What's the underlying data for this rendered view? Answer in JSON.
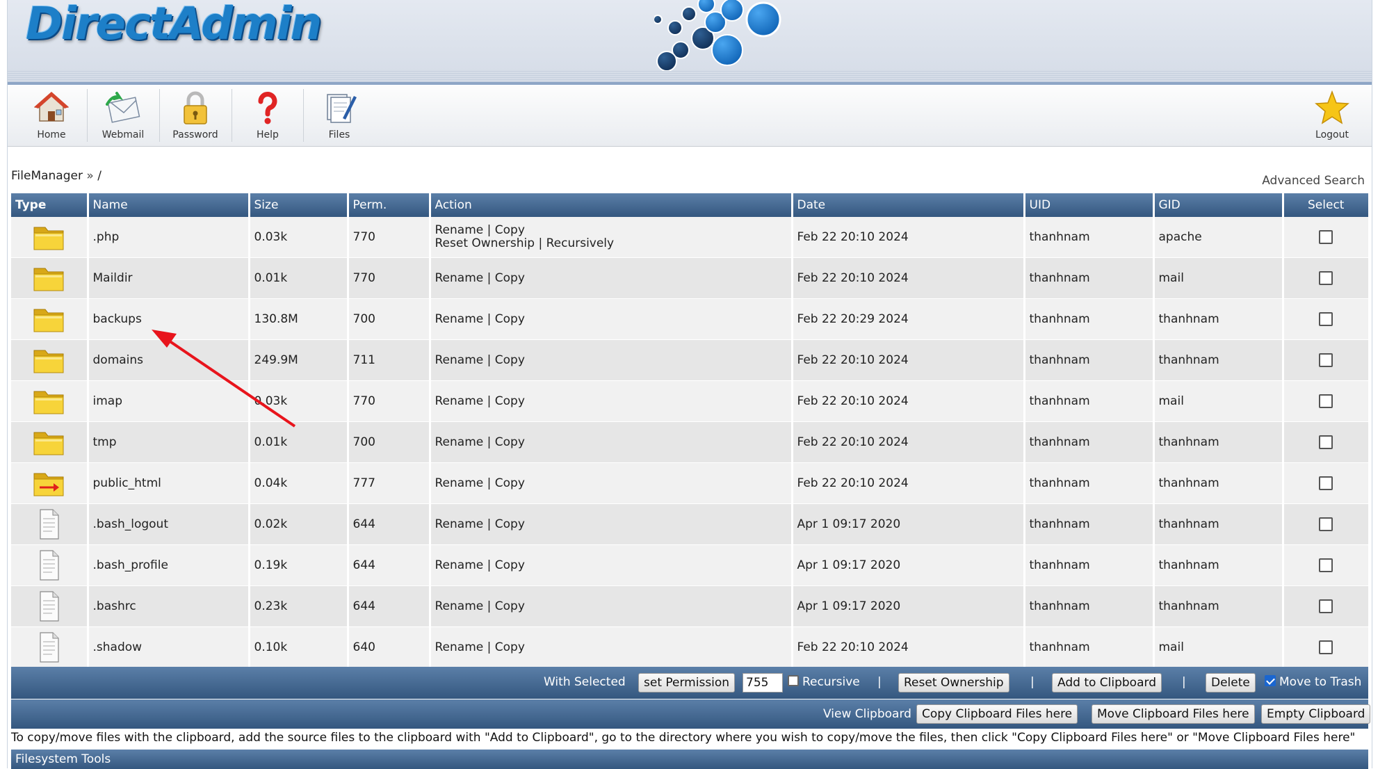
{
  "header": {
    "logo_text": "DirectAdmin"
  },
  "toolbar": {
    "items": [
      {
        "label": "Home",
        "icon": "home-icon"
      },
      {
        "label": "Webmail",
        "icon": "webmail-icon"
      },
      {
        "label": "Password",
        "icon": "password-lock-icon"
      },
      {
        "label": "Help",
        "icon": "help-question-icon"
      },
      {
        "label": "Files",
        "icon": "files-icon"
      }
    ],
    "logout": {
      "label": "Logout",
      "icon": "logout-star-icon"
    }
  },
  "breadcrumb": {
    "root": "FileManager",
    "separator": "»",
    "path": "/"
  },
  "advanced_search": "Advanced Search",
  "table": {
    "headers": {
      "type": "Type",
      "name": "Name",
      "size": "Size",
      "perm": "Perm.",
      "action": "Action",
      "date": "Date",
      "uid": "UID",
      "gid": "GID",
      "select": "Select"
    },
    "actions": {
      "rename": "Rename",
      "copy": "Copy",
      "pipe": "|",
      "reset_ownership": "Reset Ownership",
      "recursively": "Recursively"
    },
    "rows": [
      {
        "type": "folder",
        "name": ".php",
        "size": "0.03k",
        "perm": "770",
        "date": "Feb 22 20:10 2024",
        "uid": "thanhnam",
        "gid": "apache"
      },
      {
        "type": "folder",
        "name": "Maildir",
        "size": "0.01k",
        "perm": "770",
        "date": "Feb 22 20:10 2024",
        "uid": "thanhnam",
        "gid": "mail"
      },
      {
        "type": "folder",
        "name": "backups",
        "size": "130.8M",
        "perm": "700",
        "date": "Feb 22 20:29 2024",
        "uid": "thanhnam",
        "gid": "thanhnam"
      },
      {
        "type": "folder",
        "name": "domains",
        "size": "249.9M",
        "perm": "711",
        "date": "Feb 22 20:10 2024",
        "uid": "thanhnam",
        "gid": "thanhnam"
      },
      {
        "type": "folder",
        "name": "imap",
        "size": "0.03k",
        "perm": "770",
        "date": "Feb 22 20:10 2024",
        "uid": "thanhnam",
        "gid": "mail"
      },
      {
        "type": "folder",
        "name": "tmp",
        "size": "0.01k",
        "perm": "700",
        "date": "Feb 22 20:10 2024",
        "uid": "thanhnam",
        "gid": "thanhnam"
      },
      {
        "type": "symlink-folder",
        "name": "public_html",
        "size": "0.04k",
        "perm": "777",
        "date": "Feb 22 20:10 2024",
        "uid": "thanhnam",
        "gid": "thanhnam"
      },
      {
        "type": "file",
        "name": ".bash_logout",
        "size": "0.02k",
        "perm": "644",
        "date": "Apr 1 09:17 2020",
        "uid": "thanhnam",
        "gid": "thanhnam"
      },
      {
        "type": "file",
        "name": ".bash_profile",
        "size": "0.19k",
        "perm": "644",
        "date": "Apr 1 09:17 2020",
        "uid": "thanhnam",
        "gid": "thanhnam"
      },
      {
        "type": "file",
        "name": ".bashrc",
        "size": "0.23k",
        "perm": "644",
        "date": "Apr 1 09:17 2020",
        "uid": "thanhnam",
        "gid": "thanhnam"
      },
      {
        "type": "file",
        "name": ".shadow",
        "size": "0.10k",
        "perm": "640",
        "date": "Feb 22 20:10 2024",
        "uid": "thanhnam",
        "gid": "mail"
      }
    ]
  },
  "with_selected": {
    "label": "With Selected",
    "set_permission": "set Permission",
    "permission_value": "755",
    "recursive": "Recursive",
    "reset_ownership": "Reset Ownership",
    "add_to_clipboard": "Add to Clipboard",
    "delete": "Delete",
    "move_to_trash": "Move to Trash",
    "move_to_trash_checked": true,
    "pipe": "|"
  },
  "clipboard": {
    "view": "View Clipboard",
    "copy_here": "Copy Clipboard Files here",
    "move_here": "Move Clipboard Files here",
    "empty": "Empty Clipboard"
  },
  "note": "To copy/move files with the clipboard, add the source files to the clipboard with \"Add to Clipboard\", go to the directory where you wish to copy/move the files, then click \"Copy Clipboard Files here\" or \"Move Clipboard Files here\"",
  "filesystem_tools": "Filesystem Tools",
  "colors": {
    "header_blue": "#34577f",
    "logo_blue": "#1d7fc8",
    "annotation_arrow": "#e8141c"
  }
}
